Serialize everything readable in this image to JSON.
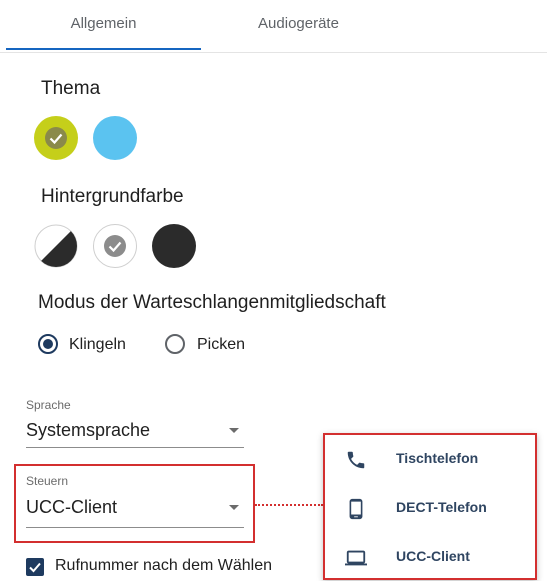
{
  "tabs": [
    {
      "label": "Allgemein",
      "active": true
    },
    {
      "label": "Audiogeräte",
      "active": false
    }
  ],
  "theme": {
    "title": "Thema",
    "swatches": [
      {
        "color": "#c5cf1a",
        "selected": true
      },
      {
        "color": "#5bc3f0",
        "selected": false
      }
    ]
  },
  "background": {
    "title": "Hintergrundfarbe",
    "swatches": [
      {
        "color": "auto-split",
        "selected": false
      },
      {
        "color": "#ffffff",
        "selected": true
      },
      {
        "color": "#2b2b2b",
        "selected": false
      }
    ]
  },
  "queue_mode": {
    "title": "Modus der Warteschlangenmitgliedschaft",
    "options": [
      {
        "label": "Klingeln",
        "checked": true
      },
      {
        "label": "Picken",
        "checked": false
      }
    ]
  },
  "language": {
    "label": "Sprache",
    "value": "Systemsprache"
  },
  "control": {
    "label": "Steuern",
    "value": "UCC-Client"
  },
  "control_menu": {
    "items": [
      {
        "label": "Tischtelefon",
        "icon": "phone-icon"
      },
      {
        "label": "DECT-Telefon",
        "icon": "mobile-phone-icon"
      },
      {
        "label": "UCC-Client",
        "icon": "laptop-icon"
      }
    ]
  },
  "dial_option": {
    "label": "Rufnummer nach dem Wählen",
    "checked": true
  },
  "colors": {
    "accent": "#1e3a5f",
    "highlight": "#d32f2f",
    "tab_indicator": "#1565c0"
  }
}
